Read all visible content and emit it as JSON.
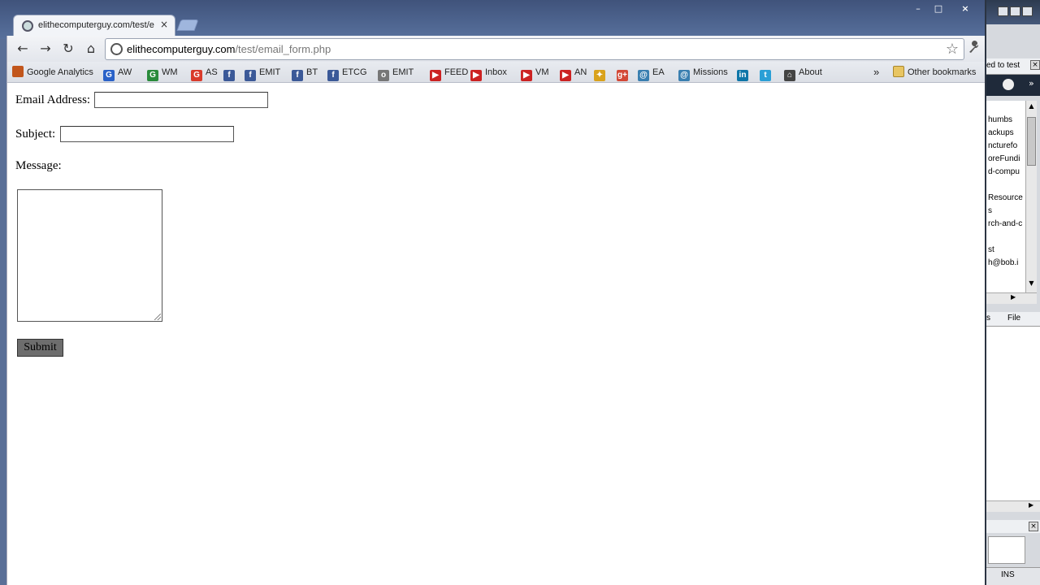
{
  "browser": {
    "tab_title": "elithecomputerguy.com/test/e",
    "tab_close": "×",
    "window_controls": {
      "minimize": "–",
      "maximize": "□",
      "close": "×"
    },
    "address": {
      "domain": "elithecomputerguy.com",
      "path": "/test/email_form.php"
    },
    "nav_icons": {
      "back": "←",
      "forward": "→",
      "reload": "↻",
      "home": "⌂",
      "star": "☆",
      "wrench": "🔧"
    },
    "bookmarks": [
      {
        "label": "Google Analytics",
        "icon": "analytics-icon",
        "color": "#c2561c",
        "glyph": ""
      },
      {
        "label": "AW",
        "icon": "google-icon",
        "color": "#2a62c8",
        "glyph": "G"
      },
      {
        "label": "WM",
        "icon": "google-icon",
        "color": "#2a8b3b",
        "glyph": "G"
      },
      {
        "label": "AS",
        "icon": "google-icon",
        "color": "#d93b2b",
        "glyph": "G"
      },
      {
        "label": "",
        "icon": "facebook-icon",
        "color": "#3b5998",
        "glyph": "f"
      },
      {
        "label": "EMIT",
        "icon": "facebook-icon",
        "color": "#3b5998",
        "glyph": "f"
      },
      {
        "label": "BT",
        "icon": "facebook-icon",
        "color": "#3b5998",
        "glyph": "f"
      },
      {
        "label": "ETCG",
        "icon": "facebook-icon",
        "color": "#3b5998",
        "glyph": "f"
      },
      {
        "label": "EMIT",
        "icon": "globe-icon",
        "color": "#777777",
        "glyph": "o"
      },
      {
        "label": "FEED",
        "icon": "youtube-icon",
        "color": "#cc2222",
        "glyph": "▶"
      },
      {
        "label": "Inbox",
        "icon": "youtube-icon",
        "color": "#cc2222",
        "glyph": "▶"
      },
      {
        "label": "VM",
        "icon": "youtube-icon",
        "color": "#cc2222",
        "glyph": "▶"
      },
      {
        "label": "AN",
        "icon": "youtube-icon",
        "color": "#cc2222",
        "glyph": "▶"
      },
      {
        "label": "",
        "icon": "pinwheel-icon",
        "color": "#d9a21c",
        "glyph": "✦"
      },
      {
        "label": "",
        "icon": "google-plus-icon",
        "color": "#d34836",
        "glyph": "g+"
      },
      {
        "label": "EA",
        "icon": "globe-icon",
        "color": "#3a7fb0",
        "glyph": "@"
      },
      {
        "label": "Missions",
        "icon": "globe-icon",
        "color": "#3a7fb0",
        "glyph": "@"
      },
      {
        "label": "",
        "icon": "linkedin-icon",
        "color": "#0e76a8",
        "glyph": "in"
      },
      {
        "label": "",
        "icon": "twitter-icon",
        "color": "#2a9fd6",
        "glyph": "t"
      },
      {
        "label": "About",
        "icon": "bookmark-icon",
        "color": "#444444",
        "glyph": "⌂"
      }
    ],
    "overflow_chevron": "»",
    "other_bookmarks": "Other bookmarks"
  },
  "form": {
    "email_label": "Email Address:",
    "subject_label": "Subject:",
    "message_label": "Message:",
    "submit_label": "Submit"
  },
  "background_app": {
    "tab_text": "ed to test",
    "list_items": [
      "humbs",
      "ackups",
      "ncturefo",
      "oreFundi",
      "d-compu",
      "",
      "Resource",
      "s",
      "rch-and-c",
      "",
      "st",
      "h@bob.i"
    ],
    "tabs": [
      "s",
      "File"
    ],
    "status": "INS"
  }
}
